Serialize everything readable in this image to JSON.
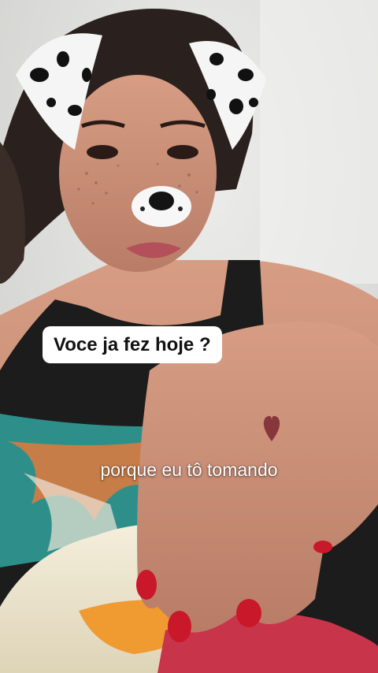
{
  "overlay": {
    "question_caption": "Voce ja fez hoje ?",
    "spoken_subtitle": "porque eu tô tomando"
  },
  "filter": {
    "name": "dalmatian-dog-ears-filter"
  },
  "colors": {
    "wall": "#d9d9d7",
    "skin": "#c98f78",
    "hair": "#2a211e",
    "tank_top": "#1c1c1c",
    "nail_polish": "#c8182a",
    "caption_bg": "#ffffff",
    "caption_text": "#111111"
  }
}
